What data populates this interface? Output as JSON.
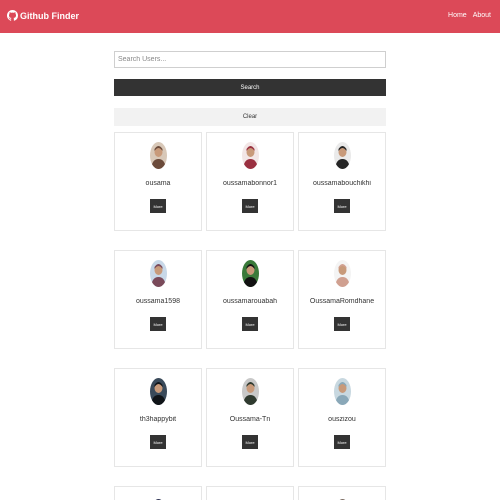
{
  "navbar": {
    "brand": "Github Finder",
    "links": [
      "Home",
      "About"
    ],
    "color": "#dc4958"
  },
  "search": {
    "placeholder": "Search Users...",
    "value": "",
    "search_label": "Search",
    "clear_label": "Clear"
  },
  "users": [
    {
      "login": "ousama",
      "button_label": "More",
      "avatar_color": "#6b4a3a",
      "bg": "#d8c8b8"
    },
    {
      "login": "oussamabonnor1",
      "button_label": "More",
      "avatar_color": "#9a3040",
      "bg": "#f2e6e6"
    },
    {
      "login": "oussamabouchikhi",
      "button_label": "More",
      "avatar_color": "#252525",
      "bg": "#eaeaea"
    },
    {
      "login": "oussama1598",
      "button_label": "More",
      "avatar_color": "#7a4a5a",
      "bg": "#c8d8e8"
    },
    {
      "login": "oussamarouabah",
      "button_label": "More",
      "avatar_color": "#111111",
      "bg": "#3a7a3a"
    },
    {
      "login": "OussamaRomdhane",
      "button_label": "More",
      "avatar_color": "#d0a090",
      "bg": "#f4f4f4"
    },
    {
      "login": "th3happybit",
      "button_label": "More",
      "avatar_color": "#101418",
      "bg": "#3a4a5a"
    },
    {
      "login": "Oussama-Tn",
      "button_label": "More",
      "avatar_color": "#2f3a2f",
      "bg": "#c8c8c8"
    },
    {
      "login": "ouszizou",
      "button_label": "More",
      "avatar_color": "#8aa8b8",
      "bg": "#c8d8e0"
    }
  ],
  "partial_avatars": [
    {
      "avatar_color": "#2a3050"
    },
    {
      "avatar_color": "#ffffff"
    },
    {
      "avatar_color": "#7a6a60"
    }
  ]
}
